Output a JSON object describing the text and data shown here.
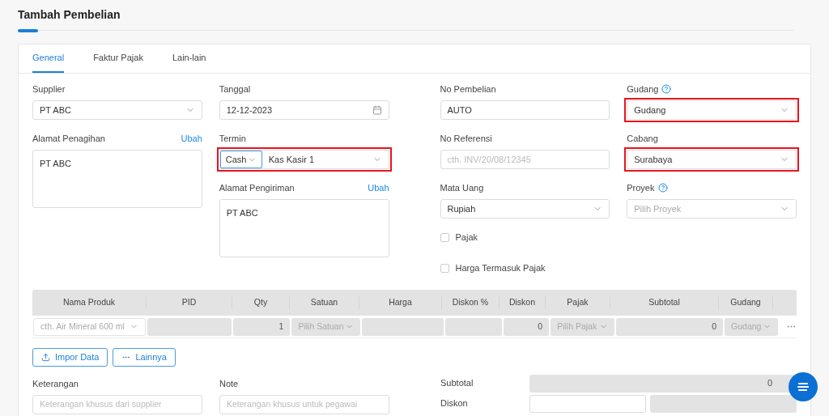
{
  "title": "Tambah Pembelian",
  "tabs": [
    {
      "label": "General",
      "selected": true
    },
    {
      "label": "Faktur Pajak",
      "selected": false
    },
    {
      "label": "Lain-lain",
      "selected": false
    }
  ],
  "columns": [
    [
      {
        "kind": "select",
        "label": "Supplier",
        "value": "PT ABC",
        "highlighted": false
      },
      {
        "kind": "textarea",
        "label": "Alamat Penagihan",
        "link": "Ubah",
        "value": "PT ABC",
        "highlighted": false
      }
    ],
    [
      {
        "kind": "date",
        "label": "Tanggal",
        "value": "12-12-2023",
        "highlighted": false
      },
      {
        "kind": "termin",
        "label": "Termin",
        "value": "Cash",
        "value_2": "Kas Kasir 1",
        "highlighted": true
      },
      {
        "kind": "textarea",
        "label": "Alamat Pengiriman",
        "link": "Ubah",
        "value": "PT ABC",
        "highlighted": false
      }
    ],
    [
      {
        "kind": "text",
        "label": "No Pembelian",
        "value": "AUTO",
        "highlighted": false
      },
      {
        "kind": "text",
        "label": "No Referensi",
        "placeholder": "cth. INV/20/08/12345",
        "highlighted": false
      },
      {
        "kind": "select",
        "label": "Mata Uang",
        "value": "Rupiah",
        "highlighted": false
      },
      {
        "kind": "checkbox",
        "label": "Pajak",
        "checked": false
      },
      {
        "kind": "checkbox",
        "label": "Harga Termasuk Pajak",
        "checked": false
      }
    ],
    [
      {
        "kind": "select",
        "label": "Gudang",
        "help": true,
        "value": "Gudang",
        "highlighted": true
      },
      {
        "kind": "select",
        "label": "Cabang",
        "value": "Surabaya",
        "highlighted": true
      },
      {
        "kind": "select",
        "label": "Proyek",
        "help": true,
        "placeholder": "Pilih Proyek",
        "highlighted": false
      }
    ]
  ],
  "table": {
    "columns": [
      "Nama Produk",
      "PID",
      "Qty",
      "Satuan",
      "Harga",
      "Diskon %",
      "Diskon",
      "Pajak",
      "Subtotal",
      "Gudang"
    ],
    "row": [
      {
        "kind": "select",
        "placeholder": "cth. Air Mineral 600 ml"
      },
      {
        "kind": "text"
      },
      {
        "kind": "number",
        "value": "1"
      },
      {
        "kind": "select",
        "placeholder": "Pilih Satuan"
      },
      {
        "kind": "text"
      },
      {
        "kind": "text"
      },
      {
        "kind": "number",
        "value": "0"
      },
      {
        "kind": "select",
        "placeholder": "Pilih Pajak"
      },
      {
        "kind": "number",
        "value": "0"
      },
      {
        "kind": "select",
        "placeholder": "Gudang"
      }
    ]
  },
  "actions": [
    {
      "kind": "upload",
      "label": "Impor Data"
    },
    {
      "kind": "more",
      "label": "Lainnya"
    }
  ],
  "notes": [
    {
      "label": "Keterangan",
      "placeholder": "Keterangan khusus dari supplier"
    },
    {
      "label": "Note",
      "placeholder": "Keterangan khusus untuk pegawai"
    }
  ],
  "summary": [
    {
      "label": "Subtotal",
      "value": "0"
    },
    {
      "label": "Diskon"
    }
  ]
}
